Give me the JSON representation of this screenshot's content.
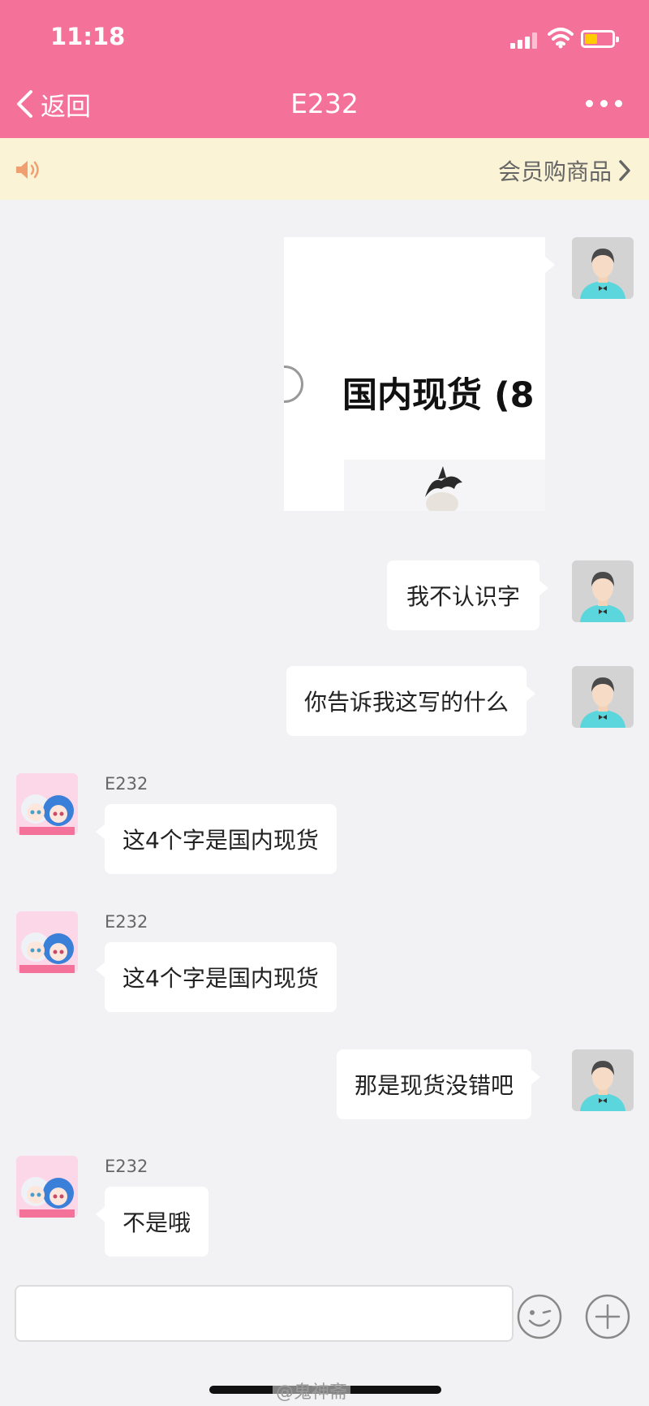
{
  "status_bar": {
    "time": "11:18"
  },
  "nav": {
    "back_label": "返回",
    "title": "E232"
  },
  "notice": {
    "link_label": "会员购商品"
  },
  "shared_image": {
    "caption": "国内现货 (8"
  },
  "messages": [
    {
      "from": "me",
      "text": "我不认识字"
    },
    {
      "from": "me",
      "text": "你告诉我这写的什么"
    },
    {
      "from": "E232",
      "sender": "E232",
      "text": "这4个字是国内现货"
    },
    {
      "from": "E232",
      "sender": "E232",
      "text": "这4个字是国内现货"
    },
    {
      "from": "me",
      "text": "那是现货没错吧"
    },
    {
      "from": "E232",
      "sender": "E232",
      "text": "不是哦"
    }
  ],
  "composer": {
    "placeholder": ""
  },
  "watermark": "@鬼神斋",
  "colors": {
    "header": "#f47199",
    "notice_bg": "#fbf3d5",
    "chat_bg": "#f2f2f4",
    "battery": "#ffcc00"
  }
}
